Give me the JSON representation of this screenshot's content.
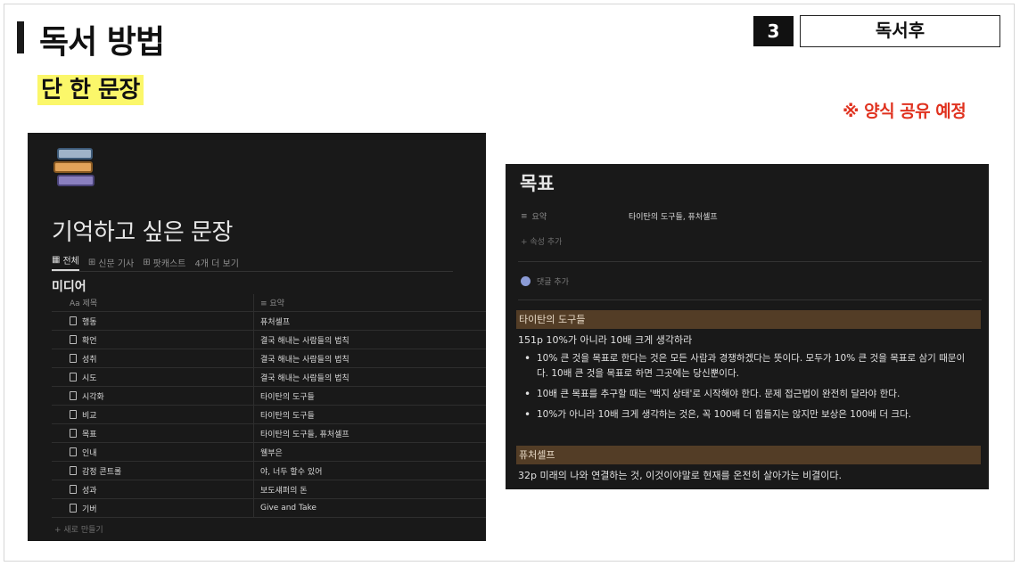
{
  "slide": {
    "title": "독서 방법",
    "subtitle": "단 한 문장",
    "step_number": "3",
    "step_label": "독서후",
    "notice": "※ 양식 공유 예정"
  },
  "left_panel": {
    "page_title": "기억하고 싶은 문장",
    "tabs": [
      {
        "icon": "table-icon",
        "label": "전체"
      },
      {
        "icon": "gallery-icon",
        "label": "신문 기사"
      },
      {
        "icon": "gallery-icon",
        "label": "팟캐스트"
      },
      {
        "icon": "",
        "label": "4개 더 보기"
      }
    ],
    "group_title": "미디어",
    "columns": [
      "Aa 제목",
      "요약"
    ],
    "rows": [
      {
        "title": "행동",
        "summary": "퓨처셀프"
      },
      {
        "title": "확언",
        "summary": "결국 해내는 사람들의 법칙"
      },
      {
        "title": "성취",
        "summary": "결국 해내는 사람들의 법칙"
      },
      {
        "title": "시도",
        "summary": "결국 해내는 사람들의 법칙"
      },
      {
        "title": "시각화",
        "summary": "타이탄의 도구들"
      },
      {
        "title": "비교",
        "summary": "타이탄의 도구들"
      },
      {
        "title": "목표",
        "summary": "타이탄의 도구들, 퓨처셀프"
      },
      {
        "title": "인내",
        "summary": "웰부은"
      },
      {
        "title": "감정 콘트롤",
        "summary": "야, 너두 할수 있어"
      },
      {
        "title": "성과",
        "summary": "보도섀퍼의 돈"
      },
      {
        "title": "기버",
        "summary": "Give and Take"
      }
    ],
    "new_row": "+ 새로 만들기"
  },
  "right_panel": {
    "page_title": "목표",
    "property_name": "요약",
    "property_value": "타이탄의 도구들, 퓨처셀프",
    "add_property": "+ 속성 추가",
    "add_comment": "댓글 추가",
    "section1_heading": "타이탄의 도구들",
    "section1_line": "151p 10%가 아니라 10배 크게 생각하라",
    "bullets": [
      "10% 큰 것을 목표로 한다는 것은 모든 사람과 경쟁하겠다는 뜻이다. 모두가 10% 큰 것을 목표로 삼기 때문이다. 10배 큰 것을 목표로 하면 그곳에는 당신뿐이다.",
      "10배 큰 목표를 추구할 때는 '백지 상태'로 시작해야 한다. 문제 접근법이 완전히 달라야 한다.",
      "10%가 아니라 10배 크게 생각하는 것은, 꼭 100배 더 힘들지는 않지만 보상은 100배 더 크다."
    ],
    "section2_heading": "퓨처셀프",
    "section2_line": "32p 미래의 나와 연결하는 것, 이것이야말로 현재를 온전히 살아가는 비결이다."
  }
}
